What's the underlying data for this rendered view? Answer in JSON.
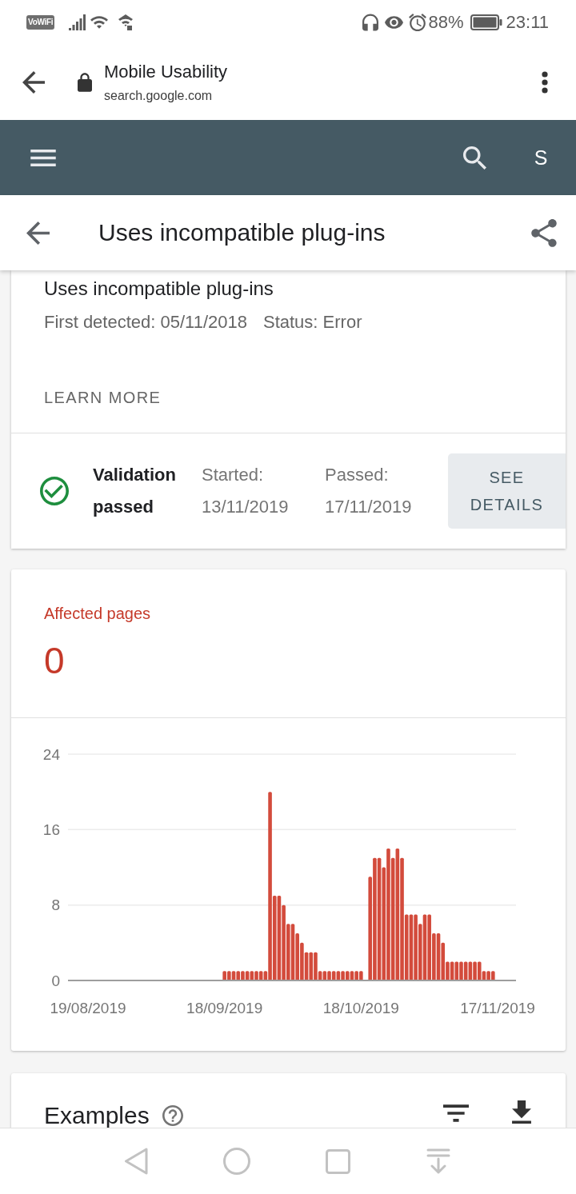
{
  "status_bar": {
    "badge": "VoWiFi",
    "battery": "88%",
    "time": "23:11"
  },
  "browser_bar": {
    "title": "Mobile Usability",
    "url": "search.google.com"
  },
  "app_bar": {
    "account_initial": "S"
  },
  "page_header": {
    "title": "Uses incompatible plug-ins"
  },
  "issue_card": {
    "title": "Uses incompatible plug-ins",
    "first_detected": "First detected: 05/11/2018",
    "status": "Status: Error",
    "link": "LEARN MORE",
    "validation": {
      "status": "Validation passed",
      "started_label": "Started:",
      "started_date": "13/11/2019",
      "passed_label": "Passed:",
      "passed_date": "17/11/2019",
      "button": "SEE DETAILS"
    }
  },
  "affected_card": {
    "label": "Affected pages",
    "count": "0",
    "chart_data": {
      "type": "bar",
      "categories": [
        "19/08/2019",
        null,
        null,
        null,
        null,
        null,
        null,
        null,
        null,
        null,
        null,
        null,
        null,
        null,
        null,
        null,
        null,
        null,
        null,
        null,
        null,
        null,
        null,
        null,
        null,
        null,
        null,
        null,
        null,
        null,
        "18/09/2019",
        null,
        null,
        null,
        null,
        null,
        null,
        null,
        null,
        null,
        null,
        null,
        null,
        null,
        null,
        null,
        null,
        null,
        null,
        null,
        null,
        null,
        null,
        null,
        null,
        null,
        null,
        null,
        null,
        null,
        "18/10/2019",
        null,
        null,
        null,
        null,
        null,
        null,
        null,
        null,
        null,
        null,
        null,
        null,
        null,
        null,
        null,
        null,
        null,
        null,
        null,
        null,
        null,
        null,
        null,
        null,
        null,
        null,
        null,
        null,
        null,
        "17/11/2019"
      ],
      "values": [
        0,
        0,
        0,
        0,
        0,
        0,
        0,
        0,
        0,
        0,
        0,
        0,
        0,
        0,
        0,
        0,
        0,
        0,
        0,
        0,
        0,
        0,
        0,
        0,
        0,
        0,
        0,
        0,
        0,
        0,
        1,
        1,
        1,
        1,
        1,
        1,
        1,
        1,
        1,
        1,
        20,
        9,
        9,
        8,
        6,
        6,
        5,
        4,
        3,
        3,
        3,
        1,
        1,
        1,
        1,
        1,
        1,
        1,
        1,
        1,
        1,
        0,
        11,
        13,
        13,
        12,
        14,
        13,
        14,
        13,
        7,
        7,
        7,
        6,
        7,
        7,
        5,
        5,
        4,
        2,
        2,
        2,
        2,
        2,
        2,
        2,
        2,
        1,
        1,
        1,
        0
      ],
      "ylim": [
        0,
        24
      ],
      "yticks": [
        0,
        8,
        16,
        24
      ]
    }
  },
  "examples_card": {
    "title": "Examples"
  }
}
